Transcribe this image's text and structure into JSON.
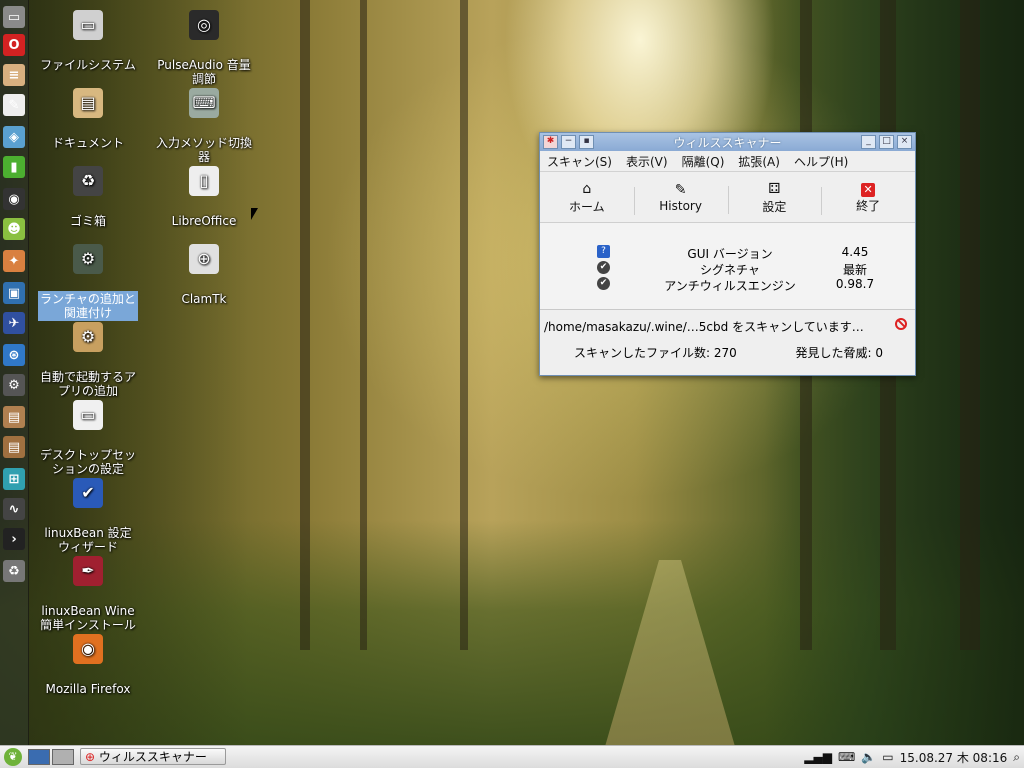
{
  "dock": {
    "items": [
      {
        "name": "files-icon",
        "glyph": "▭",
        "color": "#8a8a8a"
      },
      {
        "name": "opera-icon",
        "glyph": "O",
        "color": "#d32222"
      },
      {
        "name": "notepad-icon",
        "glyph": "≡",
        "color": "#d8b080"
      },
      {
        "name": "editor-icon",
        "glyph": "✎",
        "color": "#eeeeee"
      },
      {
        "name": "translate-icon",
        "glyph": "◈",
        "color": "#5aa0d0"
      },
      {
        "name": "terminal-green-icon",
        "glyph": "▮",
        "color": "#4caf30"
      },
      {
        "name": "media-player-icon",
        "glyph": "◉",
        "color": "#333333"
      },
      {
        "name": "game-icon",
        "glyph": "☻",
        "color": "#8ac040"
      },
      {
        "name": "paint-icon",
        "glyph": "✦",
        "color": "#d98040"
      },
      {
        "name": "image-viewer-icon",
        "glyph": "▣",
        "color": "#3070b0"
      },
      {
        "name": "bird-icon",
        "glyph": "✈",
        "color": "#3050a0"
      },
      {
        "name": "network-icon",
        "glyph": "⊛",
        "color": "#3078c8"
      },
      {
        "name": "settings-gear-icon",
        "glyph": "⚙",
        "color": "#555555"
      },
      {
        "name": "package-icon",
        "glyph": "▤",
        "color": "#b08050"
      },
      {
        "name": "package-install-icon",
        "glyph": "▤",
        "color": "#a07040"
      },
      {
        "name": "cart-icon",
        "glyph": "⊞",
        "color": "#30a0b0"
      },
      {
        "name": "system-monitor-icon",
        "glyph": "∿",
        "color": "#444444"
      },
      {
        "name": "terminal-icon",
        "glyph": "›",
        "color": "#222222"
      },
      {
        "name": "trash-dock-icon",
        "glyph": "♻",
        "color": "#777777"
      }
    ]
  },
  "desktop_icons": [
    {
      "name": "filesystem",
      "label": "ファイルシステム",
      "glyph": "▭",
      "color": "#d0d0d0"
    },
    {
      "name": "pulseaudio",
      "label": "PulseAudio 音量調節",
      "glyph": "◎",
      "color": "#2a2a2a"
    },
    {
      "name": "documents",
      "label": "ドキュメント",
      "glyph": "▤",
      "color": "#d8b880"
    },
    {
      "name": "input-method",
      "label": "入力メソッド切換器",
      "glyph": "⌨",
      "color": "#9aaaa0"
    },
    {
      "name": "trash",
      "label": "ゴミ箱",
      "glyph": "♻",
      "color": "#444444"
    },
    {
      "name": "libreoffice",
      "label": "LibreOffice",
      "glyph": "▯",
      "color": "#eeeeee"
    },
    {
      "name": "launcher",
      "label": "ランチャの追加と関連付け",
      "glyph": "⚙",
      "color": "#4a5a4a"
    },
    {
      "name": "clamtk",
      "label": "ClamTk",
      "glyph": "⊕",
      "color": "#e0e0e0"
    },
    {
      "name": "autostart",
      "label": "自動で起動するアプリの追加",
      "glyph": "⚙",
      "color": "#c8a060"
    },
    {
      "name": "session",
      "label": "デスクトップセッションの設定",
      "glyph": "▭",
      "color": "#f0f0f0"
    },
    {
      "name": "linuxbean-wizard",
      "label": "linuxBean 設定ウィザード",
      "glyph": "✔",
      "color": "#2a5ab8"
    },
    {
      "name": "wine-install",
      "label": "linuxBean Wine簡単インストール",
      "glyph": "✒",
      "color": "#a02030"
    },
    {
      "name": "firefox",
      "label": "Mozilla Firefox",
      "glyph": "◉",
      "color": "#e07020"
    }
  ],
  "window": {
    "title": "ウィルススキャナー",
    "menu": [
      "スキャン(S)",
      "表示(V)",
      "隔離(Q)",
      "拡張(A)",
      "ヘルプ(H)"
    ],
    "toolbar": [
      {
        "name": "home",
        "label": "ホーム",
        "glyph": "⌂"
      },
      {
        "name": "history",
        "label": "History",
        "glyph": "✎"
      },
      {
        "name": "settings",
        "label": "設定",
        "glyph": "⚃"
      },
      {
        "name": "quit",
        "label": "終了",
        "glyph": "✕"
      }
    ],
    "info": [
      {
        "key": "GUI バージョン",
        "value": "4.45",
        "icon": "?",
        "icon_color": "#2a62c8"
      },
      {
        "key": "シグネチャ",
        "value": "最新",
        "icon": "✔",
        "icon_color": "#444444"
      },
      {
        "key": "アンチウィルスエンジン",
        "value": "0.98.7",
        "icon": "✔",
        "icon_color": "#444444"
      }
    ],
    "scan_status": "/home/masakazu/.wine/…5cbd をスキャンしています…",
    "files_scanned": "スキャンしたファイル数: 270",
    "threats_found": "発見した脅威: 0"
  },
  "taskbar": {
    "task_label": "ウィルススキャナー",
    "datetime": "15.08.27 木 08:16"
  }
}
